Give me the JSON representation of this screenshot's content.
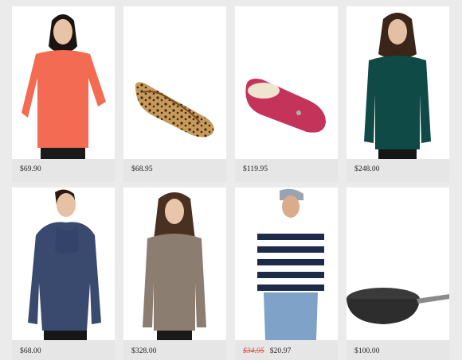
{
  "products": [
    {
      "name": "coral-oversized-sweater",
      "price": "$69.90"
    },
    {
      "name": "leopard-print-ballet-flat",
      "price": "$68.95"
    },
    {
      "name": "pink-shearling-moccasin-slipper",
      "price": "$119.95"
    },
    {
      "name": "teal-tunic-sweater",
      "price": "$248.00"
    },
    {
      "name": "navy-cowl-neck-hoodie",
      "price": "$68.00"
    },
    {
      "name": "taupe-cowl-neck-sweater",
      "price": "$328.00"
    },
    {
      "name": "striped-boatneck-top",
      "original_price": "$34.95",
      "price": "$20.97"
    },
    {
      "name": "nonstick-wok-pan",
      "price": "$100.00"
    }
  ],
  "colors": {
    "page_bg": "#ebebeb",
    "card_bg": "#e6e6e6",
    "image_bg": "#ffffff",
    "sale_red": "#e0533f"
  }
}
